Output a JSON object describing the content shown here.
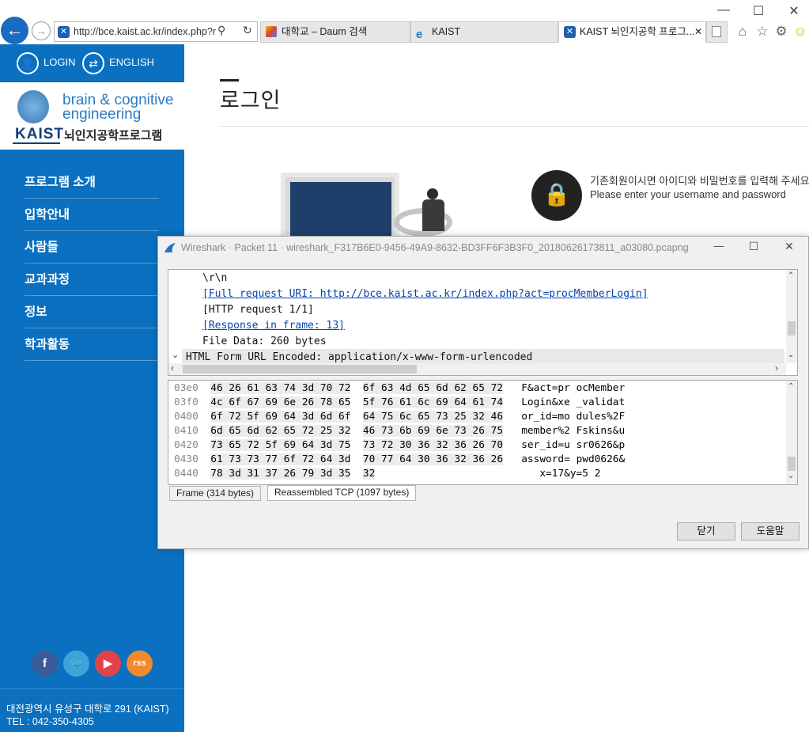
{
  "browser": {
    "url": "http://bce.kaist.ac.kr/index.php?r",
    "tabs": [
      {
        "label": "대학교 – Daum 검색"
      },
      {
        "label": "KAIST"
      },
      {
        "label": "KAIST 뇌인지공학 프로그..."
      }
    ],
    "tab_close": "✕"
  },
  "site": {
    "login_label": "LOGIN",
    "english_label": "ENGLISH",
    "logo_line1": "brain & cognitive",
    "logo_line2": "engineering",
    "logo_kaist": "KAIST",
    "logo_program": "뇌인지공학프로그램",
    "nav": [
      "프로그램 소개",
      "입학안내",
      "사람들",
      "교과과정",
      "정보",
      "학과활동"
    ],
    "social": [
      "f",
      "t",
      "▶",
      "rss"
    ],
    "address": "대전광역시 유성구 대학로 291 (KAIST)",
    "tel": "TEL : 042-350-4305",
    "page_title": "로그인",
    "login_msg_ko": "기존회원이시면 아이디와 비밀번호를 입력해 주세요",
    "login_msg_en": "Please enter your username and password"
  },
  "wireshark": {
    "title": "Wireshark · Packet 11 · wireshark_F317B6E0-9456-49A9-8632-BD3FF6F3B3F0_20180626173811_a03080.pcapng",
    "tree": {
      "line1": "\\r\\n",
      "line2": "[Full request URI: http://bce.kaist.ac.kr/index.php?act=procMemberLogin]",
      "line3": "[HTTP request 1/1]",
      "line4": "[Response in frame: 13]",
      "line5": "File Data: 260 bytes",
      "line6": "HTML Form URL Encoded: application/x-www-form-urlencoded"
    },
    "hex_rows": [
      {
        "offset": "03e0",
        "bytes1": "46 26 61 63 74 3d 70 72",
        "bytes2": "6f 63 4d 65 6d 62 65 72",
        "ascii1": "F&act=pr",
        "ascii2": "ocMember"
      },
      {
        "offset": "03f0",
        "bytes1": "4c 6f 67 69 6e 26 78 65",
        "bytes2": "5f 76 61 6c 69 64 61 74",
        "ascii1": "Login&xe",
        "ascii2": "_validat"
      },
      {
        "offset": "0400",
        "bytes1": "6f 72 5f 69 64 3d 6d 6f",
        "bytes2": "64 75 6c 65 73 25 32 46",
        "ascii1": "or_id=mo",
        "ascii2": "dules%2F"
      },
      {
        "offset": "0410",
        "bytes1": "6d 65 6d 62 65 72 25 32",
        "bytes2": "46 73 6b 69 6e 73 26 75",
        "ascii1": "member%2",
        "ascii2": "Fskins&u"
      },
      {
        "offset": "0420",
        "bytes1": "73 65 72 5f 69 64 3d 75",
        "bytes2": "73 72 30 36 32 36 26 70",
        "ascii1": "ser_id=u",
        "ascii2": "sr0626&p"
      },
      {
        "offset": "0430",
        "bytes1": "61 73 73 77 6f 72 64 3d",
        "bytes2": "70 77 64 30 36 32 36 26",
        "ascii1": "assword=",
        "ascii2": "pwd0626&"
      },
      {
        "offset": "0440",
        "bytes1": "78 3d 31 37 26 79 3d 35",
        "bytes2": "32",
        "ascii1": "x=17&y=5",
        "ascii2": "2"
      }
    ],
    "bottom_tabs": [
      "Frame (314 bytes)",
      "Reassembled TCP (1097 bytes)"
    ],
    "close_label": "닫기",
    "help_label": "도움말"
  }
}
